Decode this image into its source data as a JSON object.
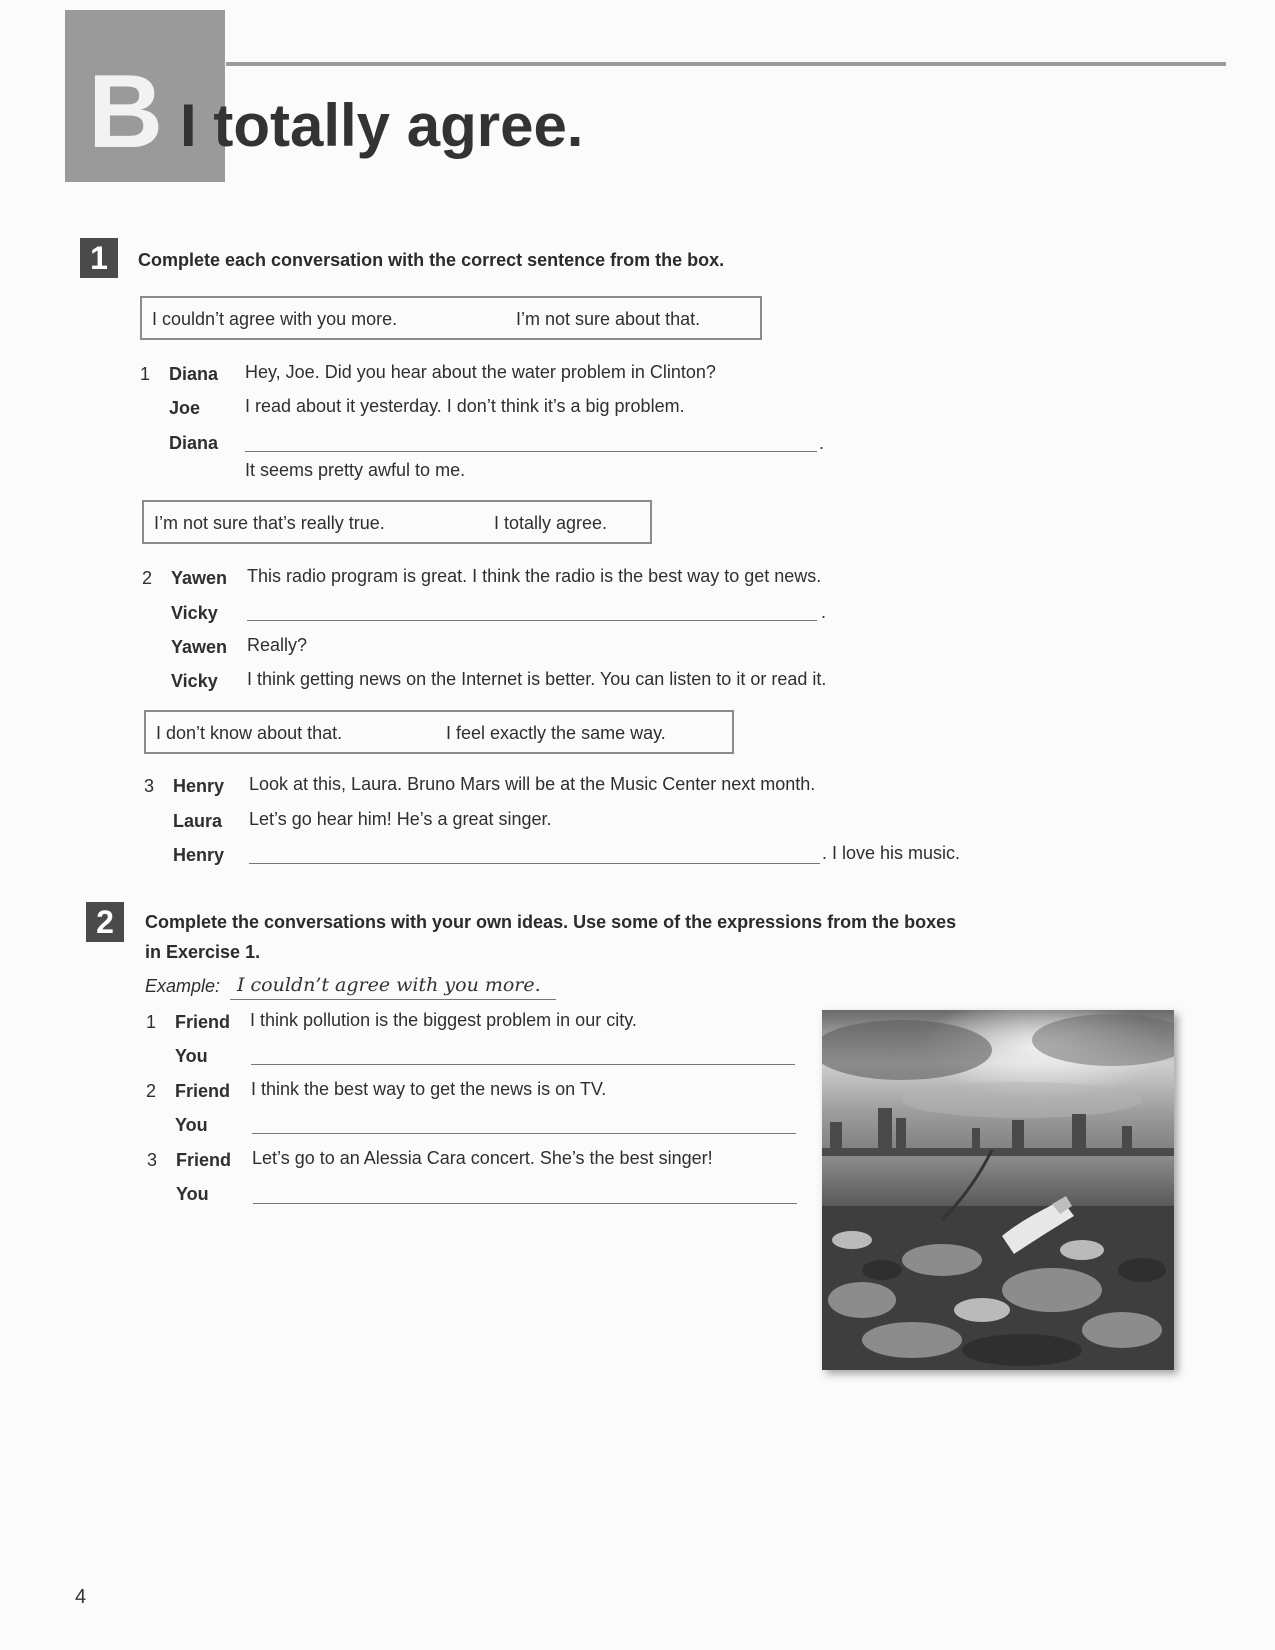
{
  "header": {
    "unit_letter": "B",
    "title": "I totally agree."
  },
  "exercise1": {
    "number": "1",
    "instruction": "Complete each conversation with the correct sentence from the box.",
    "conversations": [
      {
        "number": "1",
        "box": [
          "I couldn’t agree with you more.",
          "I’m not sure about that."
        ],
        "lines": [
          {
            "speaker": "Diana",
            "text": "Hey, Joe. Did you hear about the water problem in Clinton?"
          },
          {
            "speaker": "Joe",
            "text": "I read about it yesterday. I don’t think it’s a big problem."
          },
          {
            "speaker": "Diana",
            "after_blank": "."
          },
          {
            "speaker": "",
            "text": "It seems pretty awful to me."
          }
        ]
      },
      {
        "number": "2",
        "box": [
          "I’m not sure that’s really true.",
          "I totally agree."
        ],
        "lines": [
          {
            "speaker": "Yawen",
            "text": "This radio program is great. I think the radio is the best way to get news."
          },
          {
            "speaker": "Vicky",
            "after_blank": "."
          },
          {
            "speaker": "Yawen",
            "text": "Really?"
          },
          {
            "speaker": "Vicky",
            "text": "I think getting news on the Internet is better. You can listen to it or read it."
          }
        ]
      },
      {
        "number": "3",
        "box": [
          "I don’t know about that.",
          "I feel exactly the same way."
        ],
        "lines": [
          {
            "speaker": "Henry",
            "text": "Look at this, Laura. Bruno Mars will be at the Music Center next month."
          },
          {
            "speaker": "Laura",
            "text": "Let’s go hear him! He’s a great singer."
          },
          {
            "speaker": "Henry",
            "after_blank": ". I love his music."
          }
        ]
      }
    ]
  },
  "exercise2": {
    "number": "2",
    "instruction_line1": "Complete the conversations with your own ideas. Use some of the expressions from the boxes",
    "instruction_line2": "in Exercise 1.",
    "example_label": "Example:",
    "example_answer": "I couldn’t agree with you more.",
    "items": [
      {
        "number": "1",
        "speaker": "Friend",
        "text": "I think pollution is the biggest problem in our city.",
        "reply_speaker": "You"
      },
      {
        "number": "2",
        "speaker": "Friend",
        "text": "I think the best way to get the news is on TV.",
        "reply_speaker": "You"
      },
      {
        "number": "3",
        "speaker": "Friend",
        "text": "Let’s go to an Alessia Cara concert. She’s the best singer!",
        "reply_speaker": "You"
      }
    ]
  },
  "photo": {
    "icon": "pollution-photo"
  },
  "footer": {
    "page_number": "4"
  }
}
